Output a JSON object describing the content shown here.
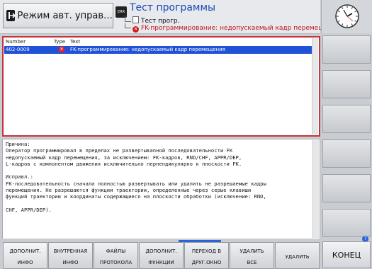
{
  "header": {
    "mode_label": "Режим авт. управ…",
    "program_badge": "ERR",
    "program_title": "Тест программы",
    "program_file": "Тест прогр.",
    "program_error": "FK-программирование: недопускаемый кадр перемещения"
  },
  "table": {
    "columns": [
      "Number",
      "Type",
      "Text"
    ],
    "rows": [
      {
        "number": "402-0009",
        "type_icon": "error-x-icon",
        "type_glyph": "✕",
        "text": "FK-программирование: недопускаемый кадр перемещения"
      }
    ]
  },
  "info": {
    "text": "Причина:\nОператор программировал в пределах не развертываnной последовательности FK\nнедопускаемый кадр перемещения, за исключением: FK-кадров, RND/CHF, APPR/DEP,\nL-кадров с компонентом движения исключительно перпендикулярно к плоскости FK.\n\nИсправл.:\nFK-последовательность сначала полностью развертывать или удалить не разрешаемые кадры\nперемещения. Не разрешаются функции траектории, определенные через серые клавиши\nфункций траектории и координаты содержащиеся на плоскости обработки (исключение: RND,\n\nCHF, APPR/DEP)."
  },
  "softkeys": [
    {
      "l1": "ДОПОЛНИТ.",
      "l2": "ИНФО"
    },
    {
      "l1": "ВНУТРЕННАЯ",
      "l2": "ИНФО"
    },
    {
      "l1": "ФАЙЛЫ",
      "l2": "ПРОТОКОЛА"
    },
    {
      "l1": "ДОПОЛНИТ.",
      "l2": "ФУНКЦИИ"
    },
    {
      "l1": "ПЕРЕХОД В",
      "l2": "ДРУГ.ОКНО"
    },
    {
      "l1": "УДАЛИТЬ",
      "l2": "ВСЕ"
    },
    {
      "l1": "УДАЛИТЬ",
      "l2": ""
    }
  ],
  "end_key": "КОНЕЦ",
  "colors": {
    "accent": "#2051d6",
    "error": "#d01c1c",
    "title": "#1b49b3"
  }
}
